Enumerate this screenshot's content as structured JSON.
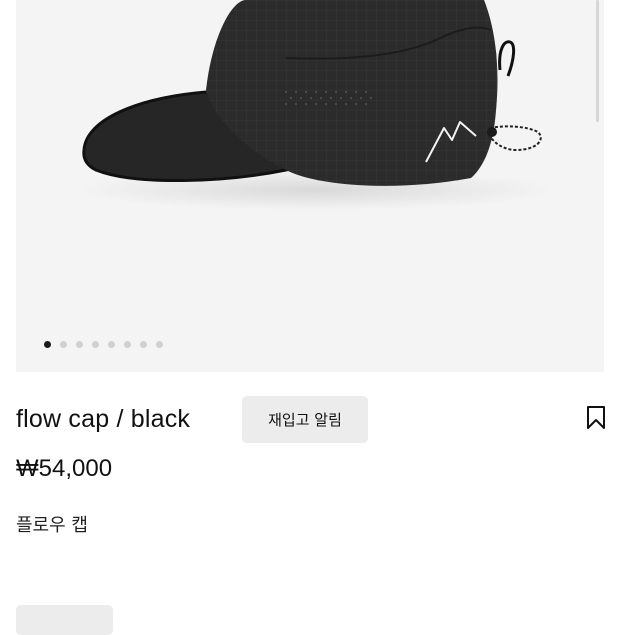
{
  "product": {
    "title": "flow cap / black",
    "price": "₩54,000",
    "subtitle": "플로우 캡",
    "restock_label": "재입고 알림",
    "bookmark_icon": "bookmark-icon"
  },
  "gallery": {
    "dot_count": 8,
    "active_index": 0
  },
  "colors": {
    "gallery_bg": "#f4f4f4",
    "button_bg": "#ececec",
    "cap": "#2b2b2b"
  }
}
